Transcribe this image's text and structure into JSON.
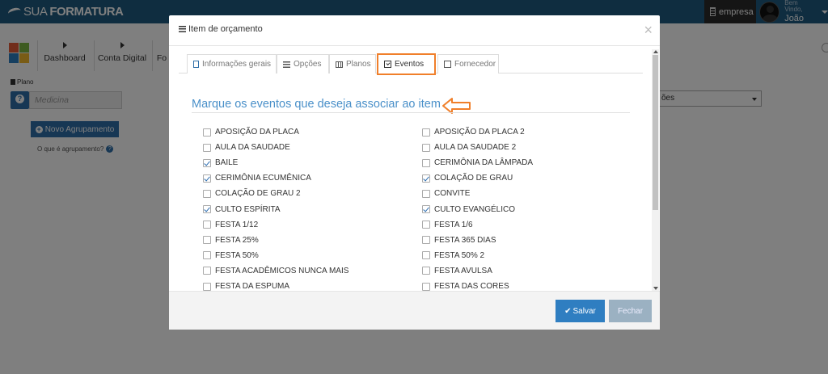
{
  "app": {
    "logo_text_1": "SUA",
    "logo_text_2": "FORMATURA"
  },
  "header": {
    "empresa_label": "empresa",
    "greeting": "Bem Vindo,",
    "user_name": "João"
  },
  "nav": {
    "items": [
      {
        "label": "Dashboard"
      },
      {
        "label": "Conta Digital"
      },
      {
        "label": "Fo"
      }
    ]
  },
  "left_panel": {
    "plano_label": "Plano",
    "plano_value": "Medicina",
    "new_group_button": "Novo Agrupamento",
    "group_help_text": "O que é agrupamento?"
  },
  "right_panel": {
    "select_value": "ões"
  },
  "modal": {
    "title": "Item de orçamento",
    "close_symbol": "×",
    "tabs": [
      {
        "label": "Informações gerais",
        "icon": "document-icon"
      },
      {
        "label": "Opções",
        "icon": "list-icon"
      },
      {
        "label": "Planos",
        "icon": "table-icon"
      },
      {
        "label": "Eventos",
        "icon": "calendar-check-icon",
        "active": true
      },
      {
        "label": "Fornecedor",
        "icon": "box-icon"
      }
    ],
    "section_title": "Marque os eventos que deseja associar ao item",
    "events_left": [
      {
        "label": "APOSIÇÃO DA PLACA",
        "checked": false
      },
      {
        "label": "AULA DA SAUDADE",
        "checked": false
      },
      {
        "label": "BAILE",
        "checked": true
      },
      {
        "label": "CERIMÔNIA ECUMÊNICA",
        "checked": true
      },
      {
        "label": "COLAÇÃO DE GRAU 2",
        "checked": false
      },
      {
        "label": "CULTO ESPÍRITA",
        "checked": true
      },
      {
        "label": "FESTA 1/12",
        "checked": false
      },
      {
        "label": "FESTA 25%",
        "checked": false
      },
      {
        "label": "FESTA 50%",
        "checked": false
      },
      {
        "label": "FESTA ACADÊMICOS NUNCA MAIS",
        "checked": false
      },
      {
        "label": "FESTA DA ESPUMA",
        "checked": false
      }
    ],
    "events_right": [
      {
        "label": "APOSIÇÃO DA PLACA 2",
        "checked": false
      },
      {
        "label": "AULA DA SAUDADE 2",
        "checked": false
      },
      {
        "label": "CERIMÔNIA DA LÂMPADA",
        "checked": false
      },
      {
        "label": "COLAÇÃO DE GRAU",
        "checked": true
      },
      {
        "label": "CONVITE",
        "checked": false
      },
      {
        "label": "CULTO EVANGÉLICO",
        "checked": true
      },
      {
        "label": "FESTA 1/6",
        "checked": false
      },
      {
        "label": "FESTA 365 DIAS",
        "checked": false
      },
      {
        "label": "FESTA 50% 2",
        "checked": false
      },
      {
        "label": "FESTA AVULSA",
        "checked": false
      },
      {
        "label": "FESTA DAS CORES",
        "checked": false
      }
    ],
    "save_button": "Salvar",
    "close_button": "Fechar"
  },
  "colors": {
    "topbar": "#1f5b80",
    "primary": "#2f7ec1",
    "highlight": "#f07f2a",
    "section_title": "#4a90c9"
  }
}
